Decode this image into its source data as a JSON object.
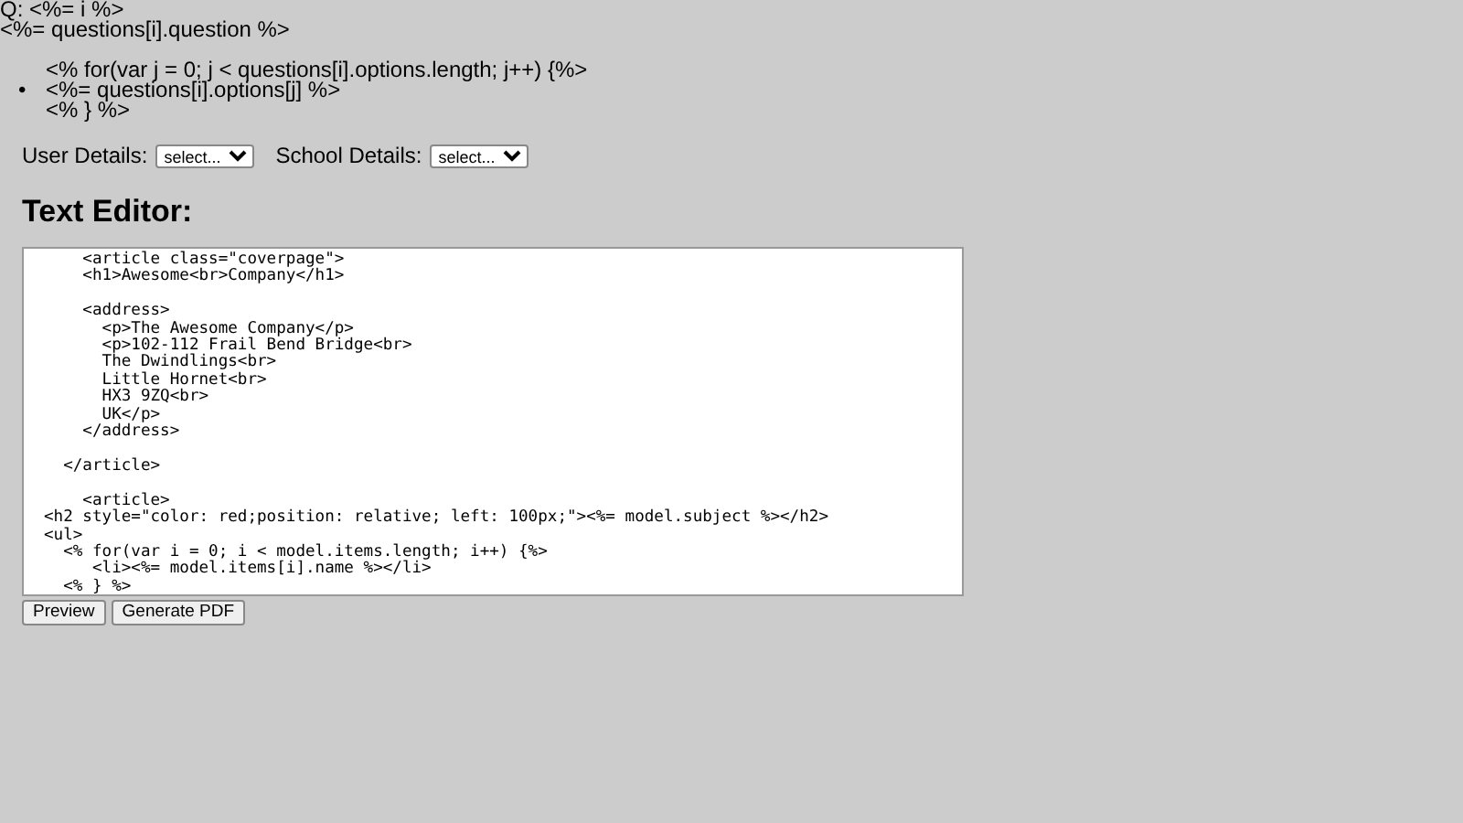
{
  "question_lines": [
    "Q: <%= i %>",
    "<%= questions[i].question %>"
  ],
  "options_list": {
    "loop_start": "<% for(var j = 0; j < questions[i].options.length; j++) {%>",
    "bullet": "•",
    "item": "<%= questions[i].options[j] %>",
    "loop_end": "<% } %>"
  },
  "selects": [
    {
      "label": "User Details:",
      "value": "select..."
    },
    {
      "label": "School Details:",
      "value": "select..."
    }
  ],
  "heading": "Text Editor:",
  "editor": {
    "value": "    <article class=\"coverpage\">\n    <h1>Awesome<br>Company</h1>\n\n    <address>\n      <p>The Awesome Company</p>\n      <p>102-112 Frail Bend Bridge<br>\n      The Dwindlings<br>\n      Little Hornet<br>\n      HX3 9ZQ<br>\n      UK</p>\n    </address>\n\n  </article>\n\n    <article>\n<h2 style=\"color: red;position: relative; left: 100px;\"><%= model.subject %></h2>\n<ul>\n  <% for(var i = 0; i < model.items.length; i++) {%>\n     <li><%= model.items[i].name %></li>\n  <% } %>"
  },
  "buttons": [
    "Preview",
    "Generate PDF"
  ]
}
